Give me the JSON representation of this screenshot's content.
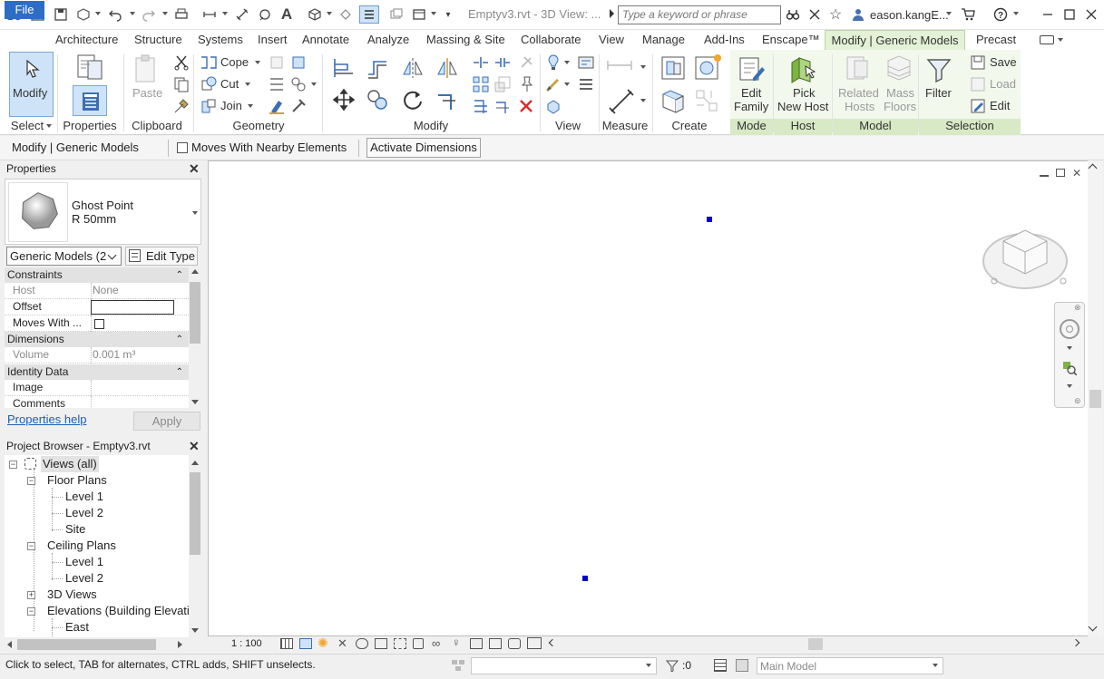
{
  "title_bar": {
    "document_title": "Emptyv3.rvt - 3D View: ...",
    "search_placeholder": "Type a keyword or phrase",
    "user_name": "eason.kangE..."
  },
  "menu": {
    "file": "File",
    "tabs": [
      "Architecture",
      "Structure",
      "Systems",
      "Insert",
      "Annotate",
      "Analyze",
      "Massing & Site",
      "Collaborate",
      "View",
      "Manage",
      "Add-Ins",
      "Enscape™"
    ],
    "active_tab": "Modify | Generic Models",
    "extra_tab": "Precast"
  },
  "ribbon": {
    "select": {
      "modify_label": "Modify",
      "panel": "Select"
    },
    "properties": {
      "panel": "Properties"
    },
    "clipboard": {
      "paste": "Paste",
      "panel": "Clipboard"
    },
    "geometry": {
      "cope": "Cope",
      "cut": "Cut",
      "join": "Join",
      "panel": "Geometry"
    },
    "modify": {
      "panel": "Modify"
    },
    "view": {
      "panel": "View"
    },
    "measure": {
      "panel": "Measure"
    },
    "create": {
      "panel": "Create"
    },
    "mode": {
      "edit_family_1": "Edit",
      "edit_family_2": "Family",
      "panel": "Mode"
    },
    "host": {
      "pick_1": "Pick",
      "pick_2": "New Host",
      "panel": "Host"
    },
    "model": {
      "related_1": "Related",
      "related_2": "Hosts",
      "mass_1": "Mass",
      "mass_2": "Floors",
      "panel": "Model"
    },
    "selection": {
      "filter": "Filter",
      "save": "Save",
      "load": "Load",
      "edit": "Edit",
      "panel": "Selection"
    }
  },
  "options_bar": {
    "context": "Modify | Generic Models",
    "moves_with_label": "Moves With Nearby Elements",
    "moves_with_checked": false,
    "activate_dimensions": "Activate Dimensions"
  },
  "properties": {
    "header": "Properties",
    "type_name": "Ghost Point",
    "type_size": "R 50mm",
    "selector": "Generic Models (2",
    "edit_type": "Edit Type",
    "groups": [
      {
        "name": "Constraints"
      },
      {
        "name": "Dimensions"
      },
      {
        "name": "Identity Data"
      }
    ],
    "rows": {
      "host_k": "Host",
      "host_v": "None",
      "offset_k": "Offset",
      "offset_v": "",
      "moves_k": "Moves With ...",
      "volume_k": "Volume",
      "volume_v": "0.001 m³",
      "image_k": "Image",
      "image_v": "",
      "comments_k": "Comments"
    },
    "help_link": "Properties help",
    "apply": "Apply"
  },
  "project_browser": {
    "header": "Project Browser - Emptyv3.rvt",
    "root": "Views (all)",
    "floor_plans": "Floor Plans",
    "floor_items": [
      "Level 1",
      "Level 2",
      "Site"
    ],
    "ceiling_plans": "Ceiling Plans",
    "ceiling_items": [
      "Level 1",
      "Level 2"
    ],
    "views_3d": "3D Views",
    "elevations": "Elevations (Building Elevatic",
    "elevation_items": [
      "East"
    ]
  },
  "view_bar": {
    "scale": "1 : 100"
  },
  "status_bar": {
    "message": "Click to select, TAB for alternates, CTRL adds, SHIFT unselects.",
    "selection_count": ":0",
    "model": "Main Model"
  },
  "colors": {
    "file_tab": "#2d6dc3",
    "context_tab": "#e3f1d6",
    "point": "#0000c8"
  }
}
